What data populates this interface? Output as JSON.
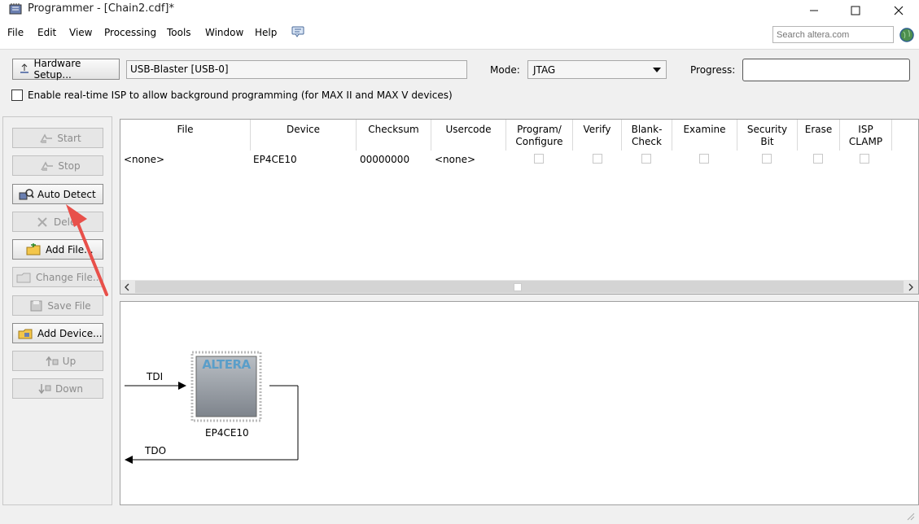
{
  "window": {
    "title": "Programmer - [Chain2.cdf]*",
    "controls": [
      "minimize",
      "maximize",
      "close"
    ]
  },
  "menu": [
    "File",
    "Edit",
    "View",
    "Processing",
    "Tools",
    "Window",
    "Help"
  ],
  "search": {
    "placeholder": "Search altera.com"
  },
  "toolbar": {
    "hardware_setup_label": "Hardware Setup...",
    "hardware_value": "USB-Blaster [USB-0]",
    "mode_label": "Mode:",
    "mode_value": "JTAG",
    "progress_label": "Progress:",
    "isp_checkbox_label": "Enable real-time ISP to allow background programming (for MAX II and MAX V devices)",
    "isp_checked": false
  },
  "side_buttons": [
    {
      "label": "Start",
      "enabled": false
    },
    {
      "label": "Stop",
      "enabled": false
    },
    {
      "label": "Auto Detect",
      "enabled": true
    },
    {
      "label": "Dele",
      "enabled": false
    },
    {
      "label": "Add File...",
      "enabled": true
    },
    {
      "label": "Change File...",
      "enabled": false
    },
    {
      "label": "Save File",
      "enabled": false
    },
    {
      "label": "Add Device...",
      "enabled": true
    },
    {
      "label": "Up",
      "enabled": false
    },
    {
      "label": "Down",
      "enabled": false
    }
  ],
  "table": {
    "headers": [
      "File",
      "Device",
      "Checksum",
      "Usercode",
      "Program/\nConfigure",
      "Verify",
      "Blank-\nCheck",
      "Examine",
      "Security\nBit",
      "Erase",
      "ISP\nCLAMP"
    ],
    "rows": [
      {
        "file": "<none>",
        "device": "EP4CE10",
        "checksum": "00000000",
        "usercode": "<none>",
        "checks": [
          false,
          false,
          false,
          false,
          false,
          false,
          false
        ]
      }
    ]
  },
  "diagram": {
    "tdi_label": "TDI",
    "tdo_label": "TDO",
    "chip_logo": "ALTERA",
    "device_label": "EP4CE10"
  },
  "colors": {
    "annotation_arrow": "#e8504a",
    "chip_logo": "#5a9ec9"
  }
}
